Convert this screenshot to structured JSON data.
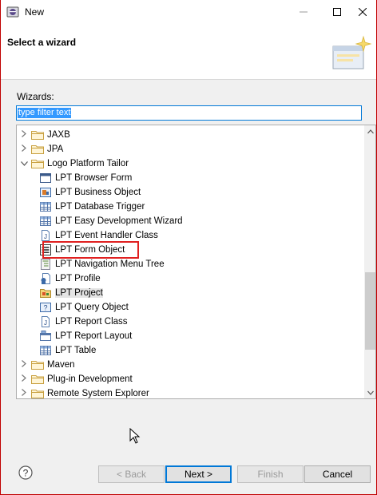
{
  "window": {
    "title": "New"
  },
  "header": {
    "title": "Select a wizard"
  },
  "wizards": {
    "label": "Wizards:",
    "filter_value": "type filter text"
  },
  "tree": {
    "rows": [
      {
        "label": "JAXB",
        "kind": "folder",
        "expanded": false,
        "level": 0
      },
      {
        "label": "JPA",
        "kind": "folder",
        "expanded": false,
        "level": 0
      },
      {
        "label": "Logo Platform Tailor",
        "kind": "folder",
        "expanded": true,
        "level": 0
      },
      {
        "label": "LPT Browser Form",
        "kind": "item",
        "icon": "browser-form-icon",
        "level": 1
      },
      {
        "label": "LPT Business Object",
        "kind": "item",
        "icon": "business-object-icon",
        "level": 1
      },
      {
        "label": "LPT Database Trigger",
        "kind": "item",
        "icon": "table-icon",
        "level": 1
      },
      {
        "label": "LPT Easy Development Wizard",
        "kind": "item",
        "icon": "table-icon",
        "level": 1
      },
      {
        "label": "LPT Event Handler Class",
        "kind": "item",
        "icon": "class-file-icon",
        "level": 1
      },
      {
        "label": "LPT Form Object",
        "kind": "item",
        "icon": "form-object-icon",
        "level": 1,
        "highlighted": true
      },
      {
        "label": "LPT Navigation Menu Tree",
        "kind": "item",
        "icon": "menu-tree-icon",
        "level": 1
      },
      {
        "label": "LPT Profile",
        "kind": "item",
        "icon": "profile-icon",
        "level": 1
      },
      {
        "label": "LPT Project",
        "kind": "item",
        "icon": "project-icon",
        "level": 1,
        "selected": true
      },
      {
        "label": "LPT Query Object",
        "kind": "item",
        "icon": "query-object-icon",
        "level": 1
      },
      {
        "label": "LPT Report Class",
        "kind": "item",
        "icon": "class-file-icon",
        "level": 1
      },
      {
        "label": "LPT Report Layout",
        "kind": "item",
        "icon": "report-layout-icon",
        "level": 1
      },
      {
        "label": "LPT Table",
        "kind": "item",
        "icon": "table-icon",
        "level": 1
      },
      {
        "label": "Maven",
        "kind": "folder",
        "expanded": false,
        "level": 0
      },
      {
        "label": "Plug-in Development",
        "kind": "folder",
        "expanded": false,
        "level": 0
      },
      {
        "label": "Remote System Explorer",
        "kind": "folder",
        "expanded": false,
        "level": 0
      }
    ]
  },
  "buttons": {
    "back": "< Back",
    "next": "Next >",
    "finish": "Finish",
    "cancel": "Cancel",
    "help": "?"
  },
  "colors": {
    "accent": "#0078d7",
    "highlight_box": "#e02020",
    "selection": "#3399ff"
  }
}
